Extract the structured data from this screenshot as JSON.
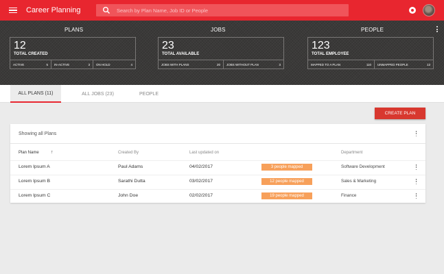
{
  "appbar": {
    "title": "Career Planning",
    "search_placeholder": "Search by Plan Name, Job ID or People"
  },
  "stats": {
    "plans": {
      "heading": "PLANS",
      "value": "12",
      "caption": "TOTAL CREATED",
      "breakdown": [
        {
          "label": "ACTIVE",
          "value": "5"
        },
        {
          "label": "IN-ACTIVE",
          "value": "3"
        },
        {
          "label": "ON HOLD",
          "value": "4"
        }
      ]
    },
    "jobs": {
      "heading": "JOBS",
      "value": "23",
      "caption": "TOTAL AVAILABLE",
      "breakdown": [
        {
          "label": "JOBS WITH PLANS",
          "value": "20"
        },
        {
          "label": "JOBS WITHOUT PLAN",
          "value": "3"
        }
      ]
    },
    "people": {
      "heading": "PEOPLE",
      "value": "123",
      "caption": "TOTAL EMPLOYEE",
      "breakdown": [
        {
          "label": "MAPPED TO A PLAN",
          "value": "110"
        },
        {
          "label": "UNMAPPED PEOPLE",
          "value": "13"
        }
      ]
    }
  },
  "tabs": [
    {
      "label": "ALL PLANS (11)",
      "active": true
    },
    {
      "label": "ALL JOBS (23)",
      "active": false
    },
    {
      "label": "PEOPLE",
      "active": false
    }
  ],
  "create_button": "CREATE PLAN",
  "plans_table": {
    "title": "Showing all Plans",
    "columns": {
      "plan_name": "Plan Name",
      "created_by": "Created By",
      "last_updated": "Last updated on",
      "department": "Department"
    },
    "rows": [
      {
        "plan": "Lorem Ipsum A",
        "created_by": "Paul Adams",
        "updated": "04/02/2017",
        "mapped": "3 people mapped",
        "department": "Software Development"
      },
      {
        "plan": "Lorem Ipsum B",
        "created_by": "Sarathi Dutta",
        "updated": "03/02/2017",
        "mapped": "12 people mapped",
        "department": "Sales & Marketing"
      },
      {
        "plan": "Lorem Ipsum C",
        "created_by": "John Doe",
        "updated": "02/02/2017",
        "mapped": "19 people mapped",
        "department": "Finance"
      }
    ]
  },
  "colors": {
    "brand_red": "#e8262f",
    "badge_orange": "#f7a05a",
    "header_dark": "#3b3a39"
  }
}
